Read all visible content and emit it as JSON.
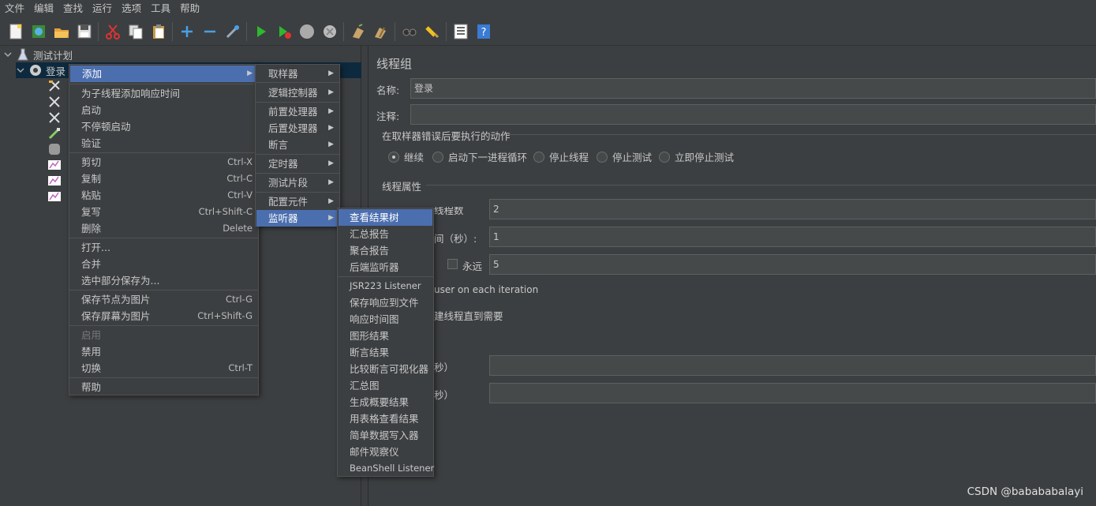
{
  "menubar": {
    "items": [
      "文件",
      "编辑",
      "查找",
      "运行",
      "选项",
      "工具",
      "帮助"
    ]
  },
  "toolbar": {
    "icons": [
      "new-icon",
      "templates-icon",
      "open-icon",
      "save-icon",
      "cut-icon",
      "copy-icon",
      "paste-icon",
      "expand-icon",
      "collapse-icon",
      "toggle-icon",
      "start-icon",
      "start-no-pause-icon",
      "stop-icon",
      "shutdown-icon",
      "clear-icon",
      "clear-all-icon",
      "search-icon",
      "reset-search-icon",
      "function-helper-icon",
      "help-icon"
    ]
  },
  "tree": {
    "root": "测试计划",
    "selected": "登录"
  },
  "panel": {
    "title": "线程组",
    "name_label": "名称:",
    "name_value": "登录",
    "comment_label": "注释:",
    "comment_value": "",
    "error_group_title": "在取样器错误后要执行的动作",
    "radios": [
      {
        "label": "继续",
        "checked": true
      },
      {
        "label": "启动下一进程循环",
        "checked": false
      },
      {
        "label": "停止线程",
        "checked": false
      },
      {
        "label": "停止测试",
        "checked": false
      },
      {
        "label": "立即停止测试",
        "checked": false
      }
    ],
    "thread_props_title": "线程属性",
    "threads_label_partial": "线程数",
    "threads_value": "2",
    "rampup_label_partial": "间（秒）:",
    "rampup_value": "1",
    "forever_label": "永远",
    "loops_value": "5",
    "same_user_partial": "user on each iteration",
    "delay_create_partial": "建线程直到需要",
    "duration_partial": "秒）",
    "startup_delay_partial": "秒）"
  },
  "context_menu": {
    "items": [
      {
        "label": "添加",
        "submenu": true,
        "highlight": true
      },
      {
        "label": "为子线程添加响应时间"
      },
      {
        "label": "启动"
      },
      {
        "label": "不停顿启动"
      },
      {
        "label": "验证"
      },
      {
        "label": "剪切",
        "accel": "Ctrl-X"
      },
      {
        "label": "复制",
        "accel": "Ctrl-C"
      },
      {
        "label": "粘贴",
        "accel": "Ctrl-V"
      },
      {
        "label": "复写",
        "accel": "Ctrl+Shift-C"
      },
      {
        "label": "删除",
        "accel": "Delete"
      },
      {
        "label": "打开..."
      },
      {
        "label": "合并"
      },
      {
        "label": "选中部分保存为..."
      },
      {
        "label": "保存节点为图片",
        "accel": "Ctrl-G"
      },
      {
        "label": "保存屏幕为图片",
        "accel": "Ctrl+Shift-G"
      },
      {
        "label": "启用",
        "disabled": true
      },
      {
        "label": "禁用"
      },
      {
        "label": "切换",
        "accel": "Ctrl-T"
      },
      {
        "label": "帮助"
      }
    ]
  },
  "add_menu": {
    "items": [
      "取样器",
      "逻辑控制器",
      "前置处理器",
      "后置处理器",
      "断言",
      "定时器",
      "测试片段",
      "配置元件",
      "监听器"
    ]
  },
  "listener_menu": {
    "items": [
      "查看结果树",
      "汇总报告",
      "聚合报告",
      "后端监听器",
      "JSR223 Listener",
      "保存响应到文件",
      "响应时间图",
      "图形结果",
      "断言结果",
      "比较断言可视化器",
      "汇总图",
      "生成概要结果",
      "用表格查看结果",
      "简单数据写入器",
      "邮件观察仪",
      "BeanShell Listener"
    ]
  },
  "watermark": "CSDN @babababalayi",
  "colors": {
    "highlight": "#4b6eaf",
    "background": "#3c3f41",
    "selected_row": "#0d293e"
  }
}
